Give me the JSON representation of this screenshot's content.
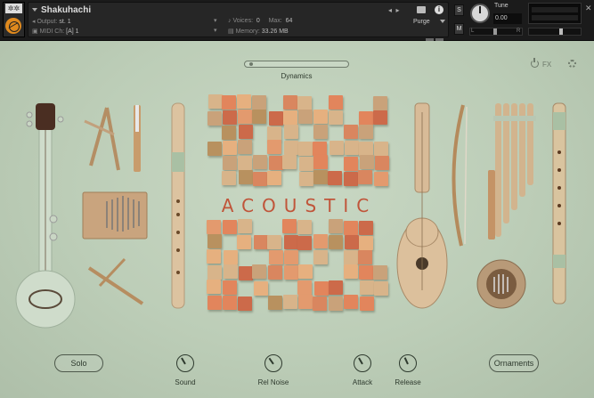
{
  "header": {
    "logo_text": "✲✲",
    "instrument_title": "Shakuhachi",
    "output_label": "Output:",
    "output_value": "st. 1",
    "midi_label": "MIDI Ch:",
    "midi_value": "[A] 1",
    "voices_label": "Voices:",
    "voices_value": "0",
    "max_label": "Max:",
    "max_value": "64",
    "memory_label": "Memory:",
    "memory_value": "33.26 MB",
    "purge_label": "Purge",
    "solo_btn": "S",
    "mute_btn": "M",
    "tune_label": "Tune",
    "tune_value": "0.00",
    "pan_left": "L",
    "pan_right": "R",
    "info_icon": "i",
    "close_icon": "✕"
  },
  "body": {
    "dynamics_label": "Dynamics",
    "fx_label": "FX",
    "brand_word": "ACOUSTIC",
    "solo_button": "Solo",
    "ornaments_button": "Ornaments",
    "knobs": [
      {
        "label": "Sound"
      },
      {
        "label": "Rel Noise"
      },
      {
        "label": "Attack"
      },
      {
        "label": "Release"
      }
    ],
    "dynamics_level": 0.03
  },
  "colors": {
    "background": "#c3d3bd",
    "accent_text": "#c0553a",
    "cube_palette": [
      "#d9865f",
      "#e39a6e",
      "#c9a27a",
      "#d8b48a",
      "#e2855c",
      "#b8915f",
      "#cc6a4a",
      "#e6b07f"
    ]
  }
}
